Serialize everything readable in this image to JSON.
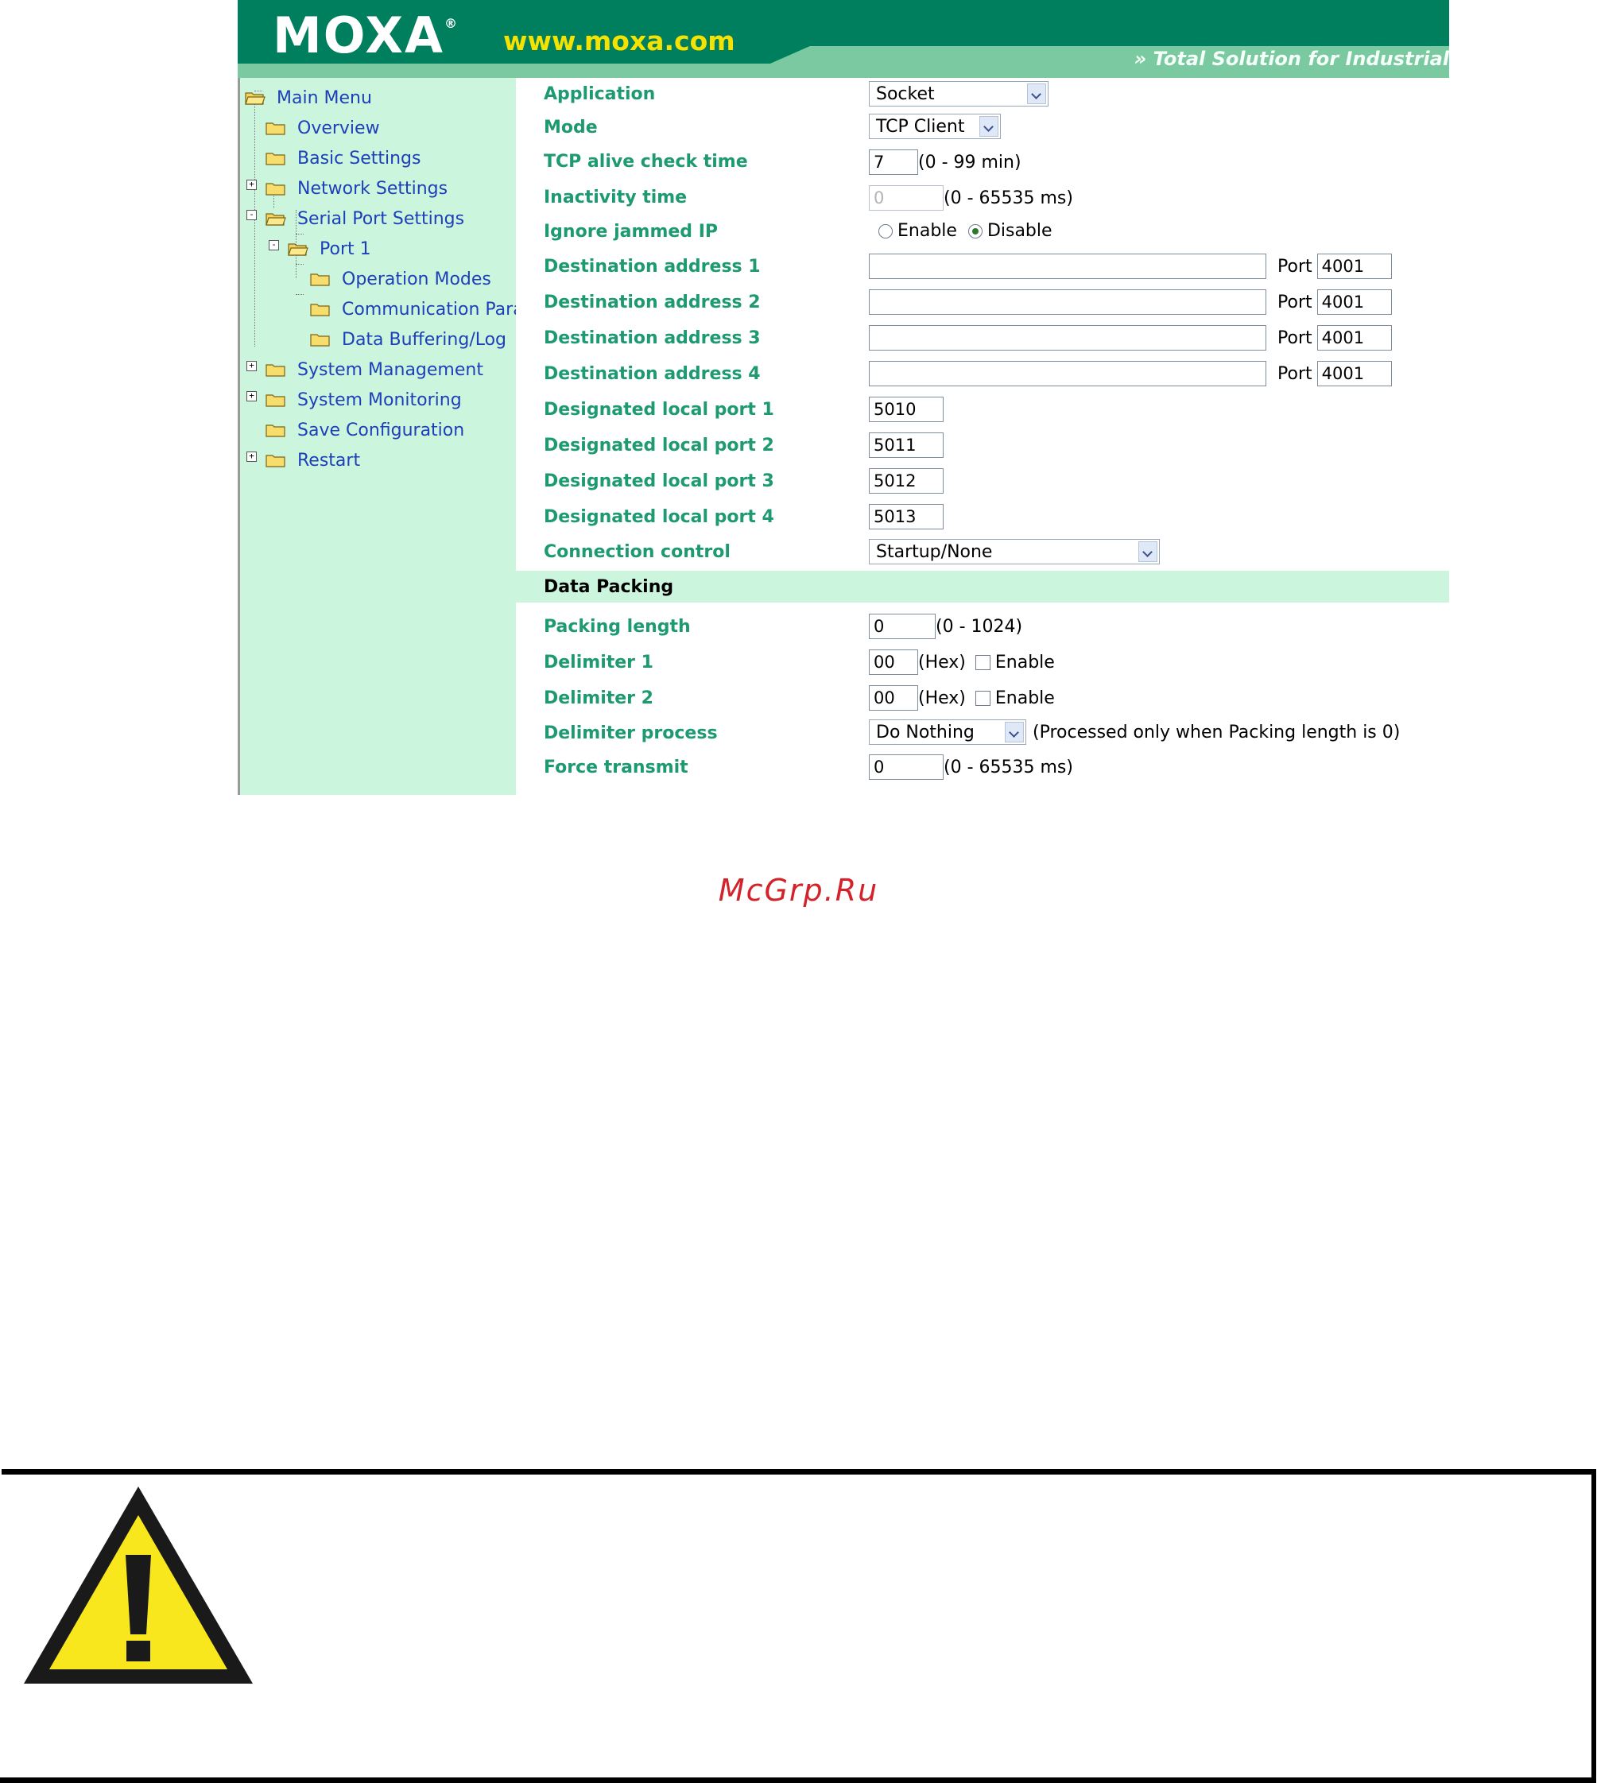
{
  "header": {
    "brand": "MOXA",
    "brand_mark": "®",
    "site": "www.moxa.com",
    "tagline": "» Total Solution for Industrial"
  },
  "sidebar": {
    "items": [
      {
        "label": "Main Menu",
        "icon": "folder-open-icon"
      },
      {
        "label": "Overview",
        "icon": "folder-icon"
      },
      {
        "label": "Basic Settings",
        "icon": "folder-icon"
      },
      {
        "label": "Network Settings",
        "icon": "folder-icon",
        "expander": "+"
      },
      {
        "label": "Serial Port Settings",
        "icon": "folder-open-icon",
        "expander": "-"
      },
      {
        "label": "Port 1",
        "icon": "folder-open-icon",
        "expander": "-"
      },
      {
        "label": "Operation Modes",
        "icon": "folder-icon"
      },
      {
        "label": "Communication Para",
        "icon": "folder-icon"
      },
      {
        "label": "Data Buffering/Log",
        "icon": "folder-icon"
      },
      {
        "label": "System Management",
        "icon": "folder-icon",
        "expander": "+"
      },
      {
        "label": "System Monitoring",
        "icon": "folder-icon",
        "expander": "+"
      },
      {
        "label": "Save Configuration",
        "icon": "folder-icon"
      },
      {
        "label": "Restart",
        "icon": "folder-icon",
        "expander": "+"
      }
    ]
  },
  "form": {
    "application": {
      "label": "Application",
      "value": "Socket"
    },
    "mode": {
      "label": "Mode",
      "value": "TCP Client"
    },
    "tcp_alive": {
      "label": "TCP alive check time",
      "value": "7",
      "hint": "(0 - 99 min)"
    },
    "inactivity": {
      "label": "Inactivity time",
      "value": "0",
      "hint": "(0 - 65535 ms)"
    },
    "ignore_jammed": {
      "label": "Ignore jammed IP",
      "opt1": "Enable",
      "opt2": "Disable",
      "selected": "Disable"
    },
    "destinations": [
      {
        "label": "Destination address 1",
        "address": "",
        "port_label": "Port",
        "port": "4001"
      },
      {
        "label": "Destination address 2",
        "address": "",
        "port_label": "Port",
        "port": "4001"
      },
      {
        "label": "Destination address 3",
        "address": "",
        "port_label": "Port",
        "port": "4001"
      },
      {
        "label": "Destination address 4",
        "address": "",
        "port_label": "Port",
        "port": "4001"
      }
    ],
    "local_ports": [
      {
        "label": "Designated local port 1",
        "value": "5010"
      },
      {
        "label": "Designated local port 2",
        "value": "5011"
      },
      {
        "label": "Designated local port 3",
        "value": "5012"
      },
      {
        "label": "Designated local port 4",
        "value": "5013"
      }
    ],
    "connection_control": {
      "label": "Connection control",
      "value": "Startup/None"
    },
    "section_title": "Data Packing",
    "packing_length": {
      "label": "Packing length",
      "value": "0",
      "hint": "(0 - 1024)"
    },
    "delimiter1": {
      "label": "Delimiter 1",
      "value": "00",
      "hint": "(Hex)",
      "check_label": "Enable",
      "checked": false
    },
    "delimiter2": {
      "label": "Delimiter 2",
      "value": "00",
      "hint": "(Hex)",
      "check_label": "Enable",
      "checked": false
    },
    "delimiter_process": {
      "label": "Delimiter process",
      "value": "Do Nothing",
      "hint": "(Processed only when Packing length is 0)"
    },
    "force_transmit": {
      "label": "Force transmit",
      "value": "0",
      "hint": "(0 - 65535 ms)"
    }
  },
  "watermark": "McGrp.Ru",
  "colors": {
    "header_dark": "#007f5f",
    "header_light": "#4dbc8c",
    "sidebar_bg": "#ccf5de",
    "label_green": "#1e9a72",
    "link_blue": "#1d3fb8",
    "warning_yellow": "#f8e71c"
  }
}
